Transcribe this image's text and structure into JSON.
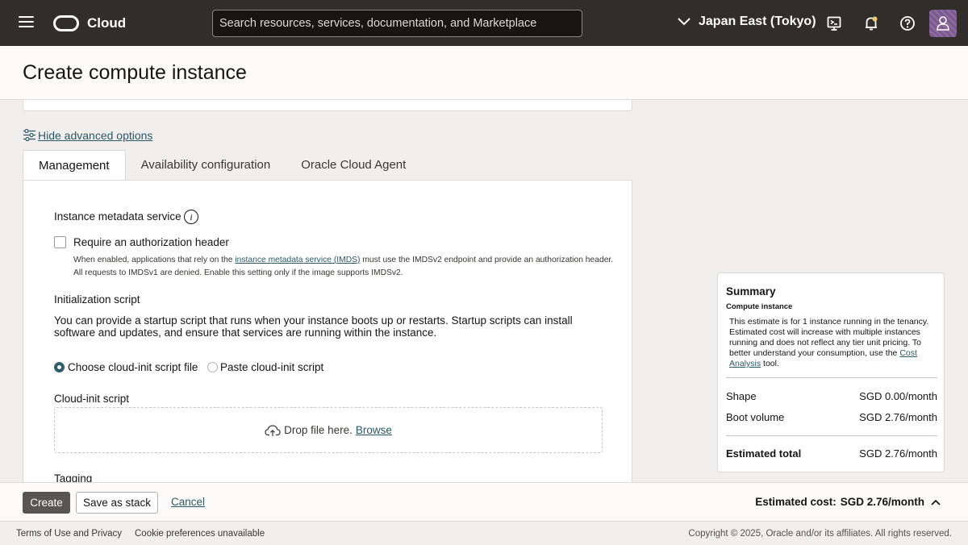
{
  "topbar": {
    "brand": "Cloud",
    "search_placeholder": "Search resources, services, documentation, and Marketplace",
    "region": "Japan East (Tokyo)",
    "icons": [
      "menu-icon",
      "oracle-logo",
      "chevron-down-icon",
      "cloud-shell-icon",
      "bell-icon",
      "help-icon",
      "user-icon"
    ],
    "avatar_color": "#7b5a8e"
  },
  "page": {
    "title": "Create compute instance"
  },
  "advanced": {
    "link_label": "Hide advanced options"
  },
  "tabs": [
    {
      "label": "Management",
      "active": true
    },
    {
      "label": "Availability configuration",
      "active": false
    },
    {
      "label": "Oracle Cloud Agent",
      "active": false
    }
  ],
  "management": {
    "imds_heading": "Instance metadata service",
    "info_glyph": "i",
    "require_auth_label": "Require an authorization header",
    "require_auth_checked": false,
    "help_before": "When enabled, applications that rely on the ",
    "help_link": "instance metadata service (IMDS)",
    "help_after": " must use the IMDSv2 endpoint and provide an authorization header. All requests to IMDSv1 are denied. Enable this setting only if the image supports IMDSv2.",
    "init_heading": "Initialization script",
    "init_description": "You can provide a startup script that runs when your instance boots up or restarts. Startup scripts can install software and updates, and ensure that services are running within the instance.",
    "radio_options": [
      {
        "label": "Choose cloud-init script file",
        "selected": true
      },
      {
        "label": "Paste cloud-init script",
        "selected": false
      }
    ],
    "cloud_init_label": "Cloud-init script",
    "drop_text": "Drop file here.",
    "browse_label": "Browse",
    "tagging_heading": "Tagging"
  },
  "summary": {
    "title": "Summary",
    "subtitle": "Compute instance",
    "note_before": "This estimate is for 1 instance running in the tenancy. Estimated cost will increase with multiple instances running and does not reflect any tier unit pricing. To better understand your consumption, use the ",
    "note_link": "Cost Analysis",
    "note_after": " tool.",
    "rows": [
      {
        "label": "Shape",
        "value": "SGD 0.00/month"
      },
      {
        "label": "Boot volume",
        "value": "SGD 2.76/month"
      }
    ],
    "total_label": "Estimated total",
    "total_value": "SGD 2.76/month"
  },
  "actions": {
    "create": "Create",
    "save_stack": "Save as stack",
    "cancel": "Cancel",
    "estimated_cost_label": "Estimated cost:",
    "estimated_cost_value": "SGD 2.76/month"
  },
  "footer": {
    "terms": "Terms of Use and Privacy",
    "cookie": "Cookie preferences unavailable",
    "copyright": "Copyright © 2025, Oracle and/or its affiliates. All rights reserved."
  }
}
